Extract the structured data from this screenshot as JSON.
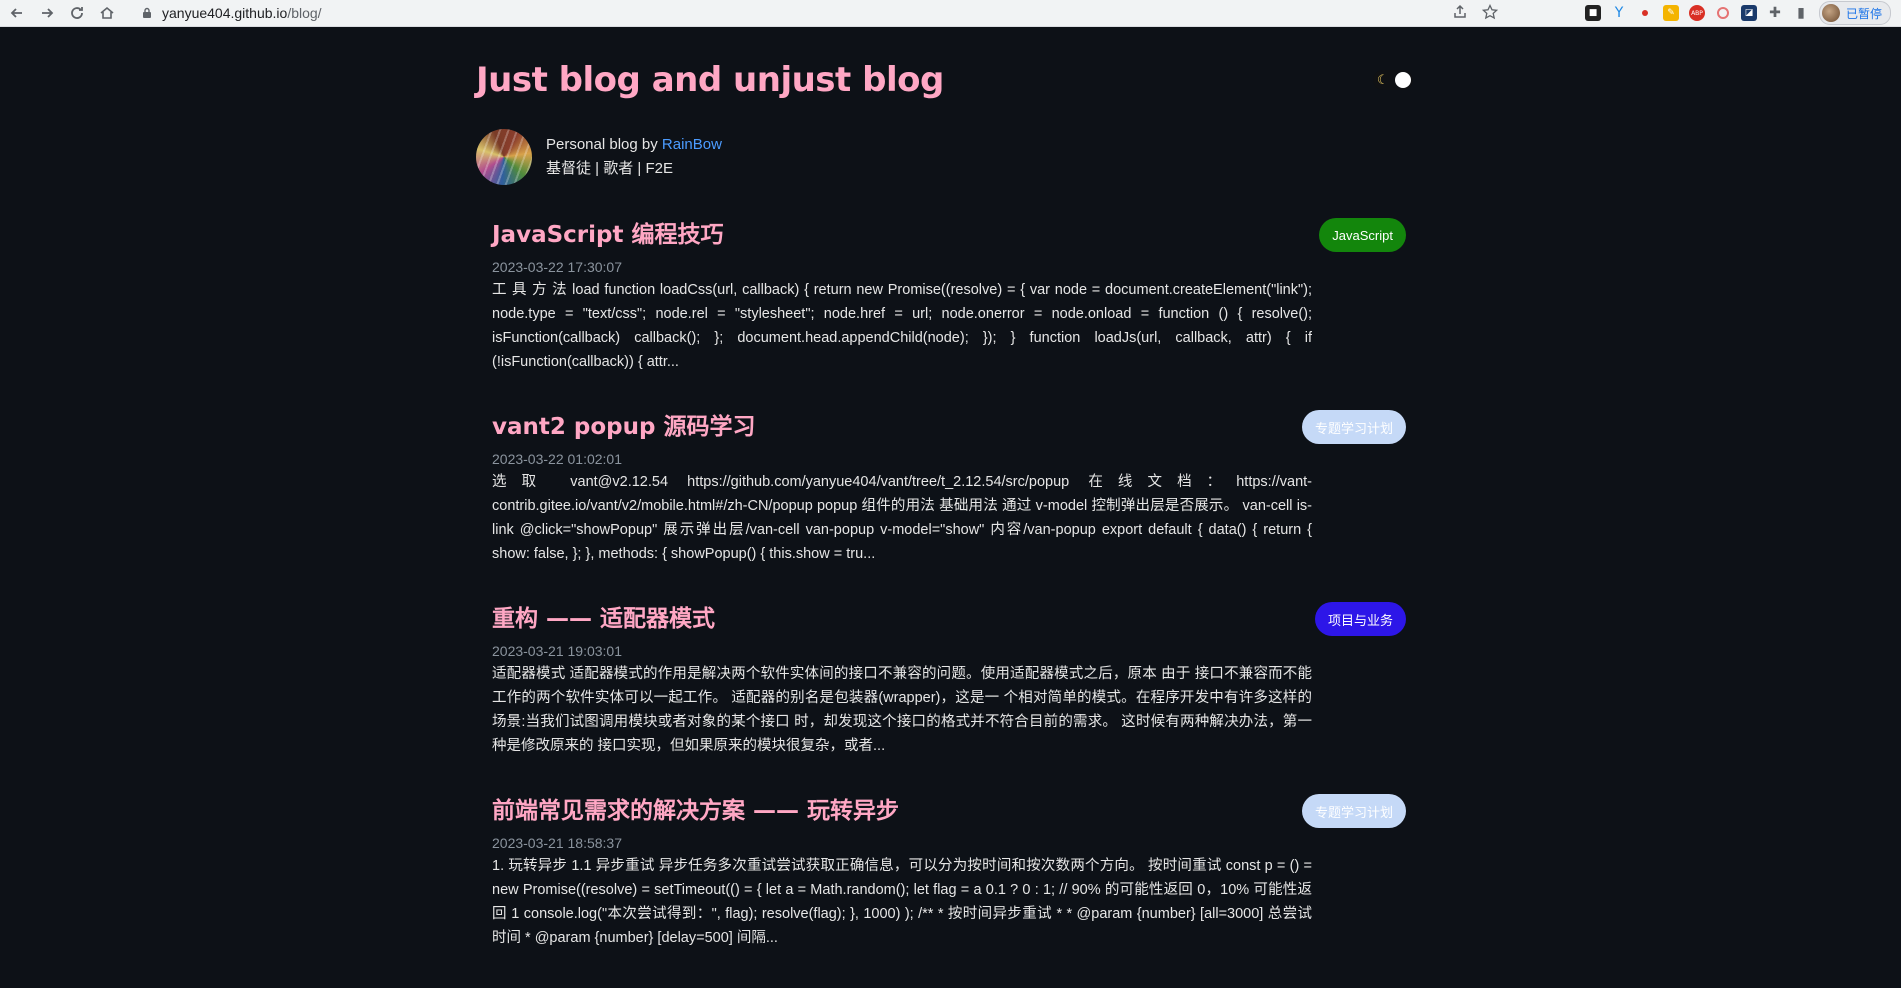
{
  "browser": {
    "url_host": "yanyue404.github.io",
    "url_path": "/blog/",
    "profile_label": "已暂停"
  },
  "site": {
    "title": "Just blog and unjust blog",
    "bio_prefix": "Personal blog by ",
    "author": "RainBow",
    "tagline": "基督徒 | 歌者 | F2E"
  },
  "posts": [
    {
      "title": "JavaScript 编程技巧",
      "date": "2023-03-22 17:30:07",
      "excerpt": "工 具 方 法  load function loadCss(url, callback) { return new Promise((resolve) = { var node = document.createElement(\"link\"); node.type = \"text/css\"; node.rel = \"stylesheet\"; node.href = url; node.onerror = node.onload = function () { resolve(); isFunction(callback) callback(); }; document.head.appendChild(node); }); } function loadJs(url, callback, attr) { if (!isFunction(callback)) { attr...",
      "tag": "JavaScript",
      "tag_bg": "#13860c",
      "tag_fg": "#ffffff"
    },
    {
      "title": "vant2 popup 源码学习",
      "date": "2023-03-22 01:02:01",
      "excerpt": "选取 vant@v2.12.54 https://github.com/yanyue404/vant/tree/t_2.12.54/src/popup 在线文档：https://vant-contrib.gitee.io/vant/v2/mobile.html#/zh-CN/popup popup 组件的用法 基础用法 通过 v-model 控制弹出层是否展示。 van-cell is-link @click=\"showPopup\" 展示弹出层/van-cell van-popup v-model=\"show\" 内容/van-popup export default { data() { return { show: false, }; }, methods: { showPopup() { this.show = tru...",
      "tag": "专题学习计划",
      "tag_bg": "#c5d9f7",
      "tag_fg": "#ffffff"
    },
    {
      "title": "重构 —— 适配器模式",
      "date": "2023-03-21 19:03:01",
      "excerpt": "适配器模式 适配器模式的作用是解决两个软件实体间的接口不兼容的问题。使用适配器模式之后，原本 由于 接口不兼容而不能工作的两个软件实体可以一起工作。 适配器的别名是包装器(wrapper)，这是一 个相对简单的模式。在程序开发中有许多这样的 场景:当我们试图调用模块或者对象的某个接口 时，却发现这个接口的格式并不符合目前的需求。 这时候有两种解决办法，第一种是修改原来的 接口实现，但如果原来的模块很复杂，或者...",
      "tag": "项目与业务",
      "tag_bg": "#2d16e8",
      "tag_fg": "#ffffff"
    },
    {
      "title": "前端常见需求的解决方案 —— 玩转异步",
      "date": "2023-03-21 18:58:37",
      "excerpt": "1. 玩转异步 1.1 异步重试 异步任务多次重试尝试获取正确信息，可以分为按时间和按次数两个方向。 按时间重试 const p = () = new Promise((resolve) = setTimeout(() = { let a = Math.random(); let flag = a 0.1 ? 0 : 1; // 90% 的可能性返回 0，10% 可能性返回 1 console.log(\"本次尝试得到：\", flag); resolve(flag); }, 1000) ); /** * 按时间异步重试 * * @param {number} [all=3000] 总尝试时间 * @param {number} [delay=500] 间隔...",
      "tag": "专题学习计划",
      "tag_bg": "#c5d9f7",
      "tag_fg": "#ffffff"
    }
  ]
}
